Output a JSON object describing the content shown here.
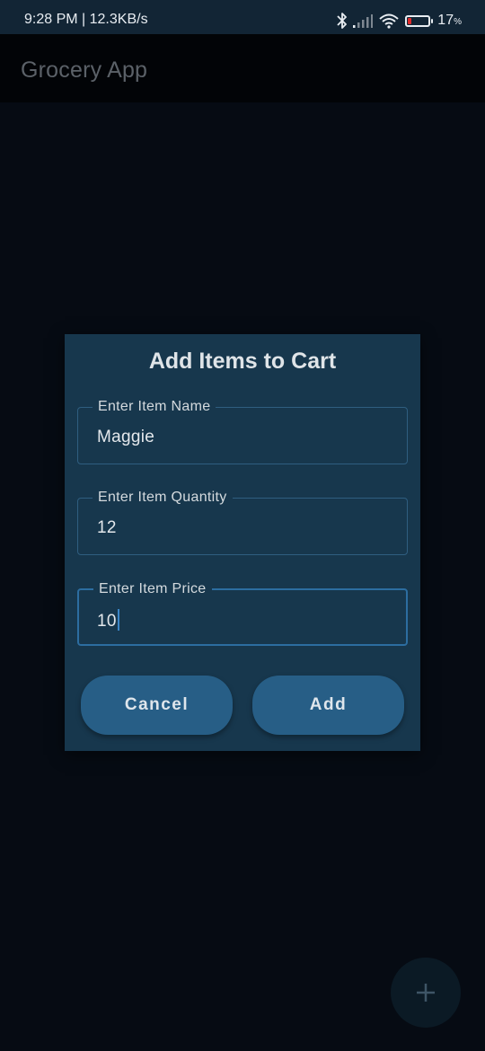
{
  "status_bar": {
    "time_speed": "9:28 PM | 12.3KB/s",
    "battery_percent": "17",
    "battery_unit": "%",
    "battery_level": 0.17,
    "icons": [
      "bluetooth-icon",
      "signal-icon",
      "wifi-icon",
      "battery-icon"
    ]
  },
  "app_bar": {
    "title": "Grocery App"
  },
  "dialog": {
    "title": "Add Items to Cart",
    "fields": [
      {
        "label": "Enter Item Name",
        "value": "Maggie"
      },
      {
        "label": "Enter Item Quantity",
        "value": "12"
      },
      {
        "label": "Enter Item Price",
        "value": "10"
      }
    ],
    "cancel_label": "Cancel",
    "add_label": "Add"
  },
  "fab": {
    "icon": "plus-icon"
  },
  "colors": {
    "background": "#060b13",
    "dialog": "#17374d",
    "button": "#275e86",
    "focus": "#2c6da0",
    "battery_low": "#e02a2a"
  }
}
